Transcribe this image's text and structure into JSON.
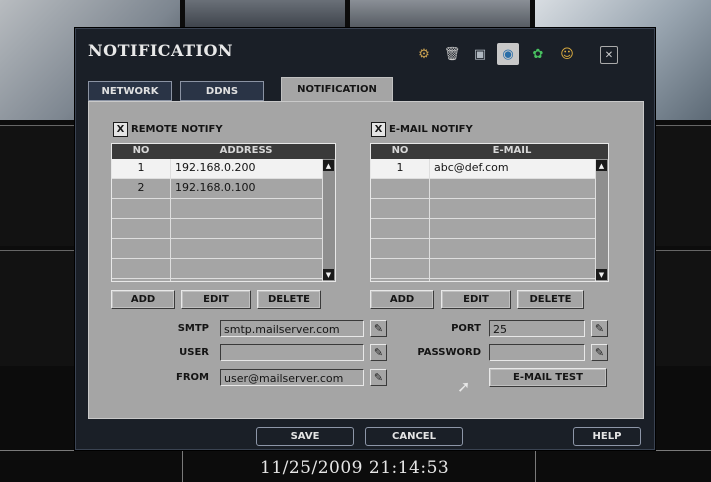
{
  "title": "NOTIFICATION",
  "toolbar_icons": [
    {
      "name": "gear-icon",
      "glyph": "⚙",
      "color": "#c8a050"
    },
    {
      "name": "trash-icon",
      "glyph": "🗑",
      "color": "#c8c8c8"
    },
    {
      "name": "monitor-icon",
      "glyph": "▣",
      "color": "#b0b8c0"
    },
    {
      "name": "network-globe-icon",
      "glyph": "◉",
      "color": "#4aa0d8"
    },
    {
      "name": "record-icon",
      "glyph": "✿",
      "color": "#48c060"
    },
    {
      "name": "user-icon",
      "glyph": "☺",
      "color": "#e0b040"
    },
    {
      "name": "close-icon",
      "glyph": "✕",
      "color": "#d0d0d0"
    }
  ],
  "tabs": [
    "NETWORK",
    "DDNS",
    "NOTIFICATION"
  ],
  "remote": {
    "checkbox": "X",
    "label": "REMOTE NOTIFY",
    "col_no": "NO",
    "col_address": "ADDRESS",
    "rows": [
      {
        "no": "1",
        "address": "192.168.0.200"
      },
      {
        "no": "2",
        "address": "192.168.0.100"
      },
      {
        "no": "",
        "address": ""
      },
      {
        "no": "",
        "address": ""
      },
      {
        "no": "",
        "address": ""
      },
      {
        "no": "",
        "address": ""
      }
    ]
  },
  "email": {
    "checkbox": "X",
    "label": "E-MAIL NOTIFY",
    "col_no": "NO",
    "col_email": "E-MAIL",
    "rows": [
      {
        "no": "1",
        "address": "abc@def.com"
      },
      {
        "no": "",
        "address": ""
      },
      {
        "no": "",
        "address": ""
      },
      {
        "no": "",
        "address": ""
      },
      {
        "no": "",
        "address": ""
      },
      {
        "no": "",
        "address": ""
      }
    ]
  },
  "buttons": {
    "add": "ADD",
    "edit": "EDIT",
    "delete": "DELETE"
  },
  "smtp": {
    "smtp_label": "SMTP",
    "smtp_value": "smtp.mailserver.com",
    "user_label": "USER",
    "user_value": "",
    "from_label": "FROM",
    "from_value": "user@mailserver.com",
    "port_label": "PORT",
    "port_value": "25",
    "password_label": "PASSWORD",
    "password_value": "",
    "test_button": "E-MAIL TEST"
  },
  "footer": {
    "save": "SAVE",
    "cancel": "CANCEL",
    "help": "HELP"
  },
  "timestamp": "11/25/2009 21:14:53",
  "colors": {
    "panel": "#a5a5a5",
    "dialog_bg": "#1a1f27",
    "list_header": "#3a3a3a",
    "selected_row": "#f2f2f2"
  }
}
